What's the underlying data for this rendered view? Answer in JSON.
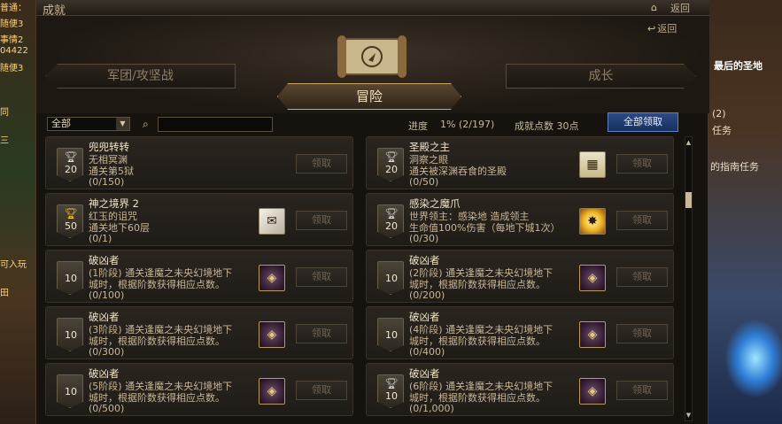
{
  "window": {
    "title": "成就",
    "close_label": "返回",
    "back_label": "返回"
  },
  "background": {
    "chat_lines": [
      "普通：",
      "随便3",
      "事情2",
      "04422",
      "随便3",
      "同",
      "三",
      "可入玩",
      "田"
    ],
    "right_texts": [
      "(2)",
      "最后的圣地",
      "任务",
      "的指南任务"
    ]
  },
  "tabs": {
    "left": "军团/攻坚战",
    "active": "冒险",
    "right": "成长"
  },
  "filter": {
    "selected": "全部",
    "search_placeholder": ""
  },
  "summary": {
    "progress_label": "进度",
    "progress_percent": "1%",
    "progress_count": "(2/197)",
    "points_label": "成就点数 30点",
    "claim_all_label": "全部领取"
  },
  "achievements": [
    {
      "name": "兜兜转转",
      "desc1": "无相冥渊",
      "desc2": "通关第5狱",
      "progress": "(0/150)",
      "points": "20",
      "trophy": "silver",
      "reward_icon": "none",
      "claim_label": "领取"
    },
    {
      "name": "圣殿之主",
      "desc1": "洞察之眼",
      "desc2": "通关被深渊吞食的圣殿",
      "progress": "(0/50)",
      "points": "20",
      "trophy": "silver",
      "reward_icon": "note",
      "claim_label": "领取"
    },
    {
      "name": "神之境界 2",
      "desc1": "红玉的诅咒",
      "desc2": "通关地下60层",
      "progress": "(0/1)",
      "points": "50",
      "trophy": "gold",
      "reward_icon": "scroll",
      "claim_label": "领取"
    },
    {
      "name": "感染之魔爪",
      "desc1": "世界领主：感染地       造成领主",
      "desc2": "生命值100%伤害（每地下城1次）",
      "progress": "(0/30)",
      "points": "20",
      "trophy": "silver",
      "reward_icon": "gold",
      "claim_label": "领取"
    },
    {
      "name": "破凶者",
      "desc1": "(1阶段) 通关逢魔之未央幻境地下",
      "desc2": "城时，根据阶数获得相应点数。",
      "progress": "(0/100)",
      "points": "10",
      "trophy": "none",
      "reward_icon": "crest",
      "claim_label": "领取"
    },
    {
      "name": "破凶者",
      "desc1": "(2阶段) 通关逢魔之未央幻境地下",
      "desc2": "城时，根据阶数获得相应点数。",
      "progress": "(0/200)",
      "points": "10",
      "trophy": "none",
      "reward_icon": "crest",
      "claim_label": "领取"
    },
    {
      "name": "破凶者",
      "desc1": "(3阶段) 通关逢魔之未央幻境地下",
      "desc2": "城时，根据阶数获得相应点数。",
      "progress": "(0/300)",
      "points": "10",
      "trophy": "none",
      "reward_icon": "crest",
      "claim_label": "领取"
    },
    {
      "name": "破凶者",
      "desc1": "(4阶段) 通关逢魔之未央幻境地下",
      "desc2": "城时，根据阶数获得相应点数。",
      "progress": "(0/400)",
      "points": "10",
      "trophy": "none",
      "reward_icon": "crest",
      "claim_label": "领取"
    },
    {
      "name": "破凶者",
      "desc1": "(5阶段) 通关逢魔之未央幻境地下",
      "desc2": "城时，根据阶数获得相应点数。",
      "progress": "(0/500)",
      "points": "10",
      "trophy": "none",
      "reward_icon": "crest",
      "claim_label": "领取"
    },
    {
      "name": "破凶者",
      "desc1": "(6阶段) 通关逢魔之未央幻境地下",
      "desc2": "城时，根据阶数获得相应点数。",
      "progress": "(0/1,000)",
      "points": "10",
      "trophy": "silver",
      "reward_icon": "crest",
      "claim_label": "领取"
    }
  ],
  "colors": {
    "accent_blue": "#2c4a86",
    "gold_border": "#c9a86a",
    "panel_bg": "#16130f"
  }
}
